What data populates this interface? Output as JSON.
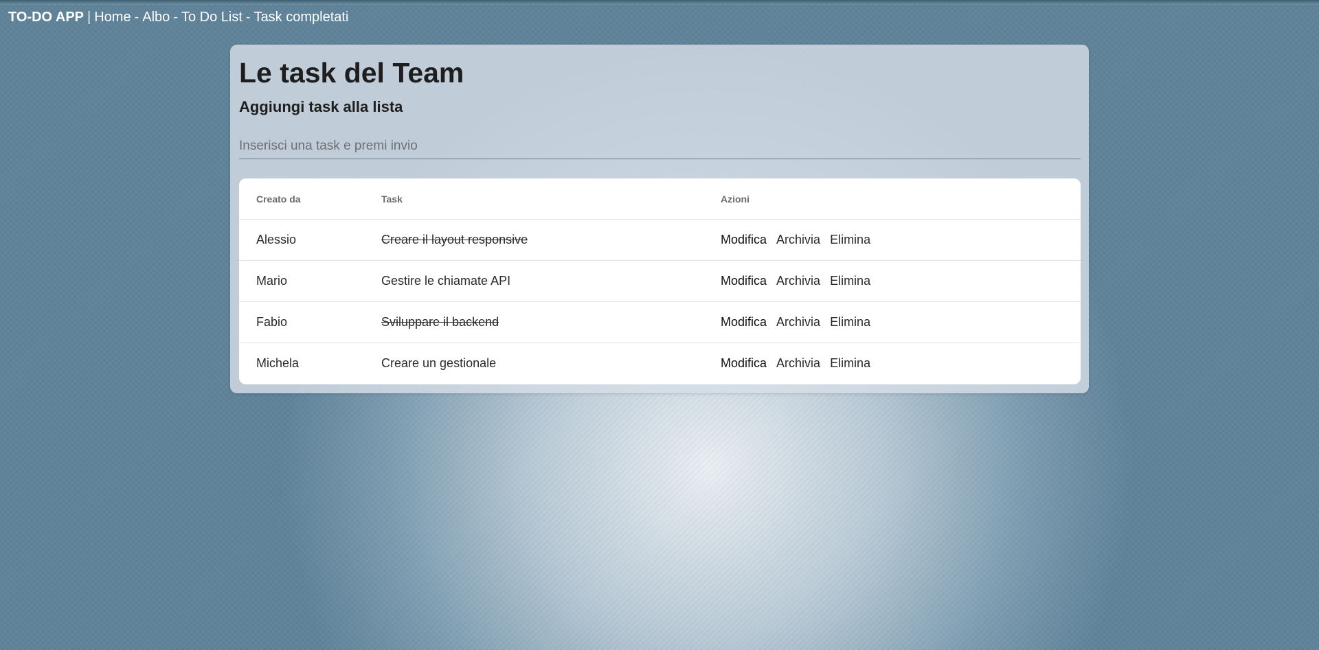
{
  "nav": {
    "brand": "TO-DO APP",
    "brand_sep": "|",
    "link_sep": "-",
    "links": [
      "Home",
      "Albo",
      "To Do List",
      "Task completati"
    ]
  },
  "main": {
    "title": "Le task del Team",
    "subtitle": "Aggiungi task alla lista",
    "input_placeholder": "Inserisci una task e premi invio"
  },
  "table": {
    "headers": [
      "Creato da",
      "Task",
      "Azioni"
    ],
    "actions": [
      "Modifica",
      "Archivia",
      "Elimina"
    ],
    "rows": [
      {
        "author": "Alessio",
        "task": "Creare il layout responsive",
        "completed": true
      },
      {
        "author": "Mario",
        "task": "Gestire le chiamate API",
        "completed": false
      },
      {
        "author": "Fabio",
        "task": "Sviluppare il backend",
        "completed": true
      },
      {
        "author": "Michela",
        "task": "Creare un gestionale",
        "completed": false
      }
    ]
  }
}
